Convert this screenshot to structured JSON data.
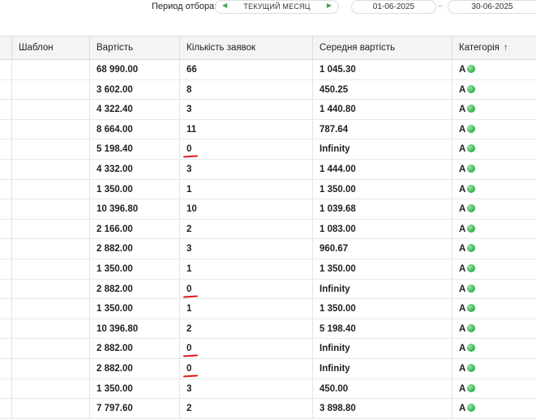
{
  "filter": {
    "period_label": "Период отбора:",
    "period_value": "ТЕКУЩИЙ МЕСЯЦ",
    "date_from": "01-06-2025",
    "date_separator": "–",
    "date_to": "30-06-2025",
    "arrow_color": "#3aa757"
  },
  "table": {
    "columns": [
      "Шаблон",
      "Вартість",
      "Кількість заявок",
      "Середня вартість",
      "Категорія"
    ],
    "sort_column": "Категорія",
    "sort_icon": "arrow-up-icon",
    "category_dot_color": "#2fae4a",
    "highlight_color": "#e01818",
    "rows": [
      {
        "template": "",
        "cost": "68 990.00",
        "count": "66",
        "avg": "1 045.30",
        "category": "A",
        "marked": false
      },
      {
        "template": "",
        "cost": "3 602.00",
        "count": "8",
        "avg": "450.25",
        "category": "A",
        "marked": false
      },
      {
        "template": "",
        "cost": "4 322.40",
        "count": "3",
        "avg": "1 440.80",
        "category": "A",
        "marked": false
      },
      {
        "template": "",
        "cost": "8 664.00",
        "count": "11",
        "avg": "787.64",
        "category": "A",
        "marked": false
      },
      {
        "template": "",
        "cost": "5 198.40",
        "count": "0",
        "avg": "Infinity",
        "category": "A",
        "marked": true
      },
      {
        "template": "",
        "cost": "4 332.00",
        "count": "3",
        "avg": "1 444.00",
        "category": "A",
        "marked": false
      },
      {
        "template": "",
        "cost": "1 350.00",
        "count": "1",
        "avg": "1 350.00",
        "category": "A",
        "marked": false
      },
      {
        "template": "",
        "cost": "10 396.80",
        "count": "10",
        "avg": "1 039.68",
        "category": "A",
        "marked": false
      },
      {
        "template": "",
        "cost": "2 166.00",
        "count": "2",
        "avg": "1 083.00",
        "category": "A",
        "marked": false
      },
      {
        "template": "",
        "cost": "2 882.00",
        "count": "3",
        "avg": "960.67",
        "category": "A",
        "marked": false
      },
      {
        "template": "",
        "cost": "1 350.00",
        "count": "1",
        "avg": "1 350.00",
        "category": "A",
        "marked": false
      },
      {
        "template": "",
        "cost": "2 882.00",
        "count": "0",
        "avg": "Infinity",
        "category": "A",
        "marked": true
      },
      {
        "template": "",
        "cost": "1 350.00",
        "count": "1",
        "avg": "1 350.00",
        "category": "A",
        "marked": false
      },
      {
        "template": "",
        "cost": "10 396.80",
        "count": "2",
        "avg": "5 198.40",
        "category": "A",
        "marked": false
      },
      {
        "template": "",
        "cost": "2 882.00",
        "count": "0",
        "avg": "Infinity",
        "category": "A",
        "marked": true
      },
      {
        "template": "",
        "cost": "2 882.00",
        "count": "0",
        "avg": "Infinity",
        "category": "A",
        "marked": true
      },
      {
        "template": "",
        "cost": "1 350.00",
        "count": "3",
        "avg": "450.00",
        "category": "A",
        "marked": false
      },
      {
        "template": "",
        "cost": "7 797.60",
        "count": "2",
        "avg": "3 898.80",
        "category": "A",
        "marked": false
      }
    ]
  }
}
